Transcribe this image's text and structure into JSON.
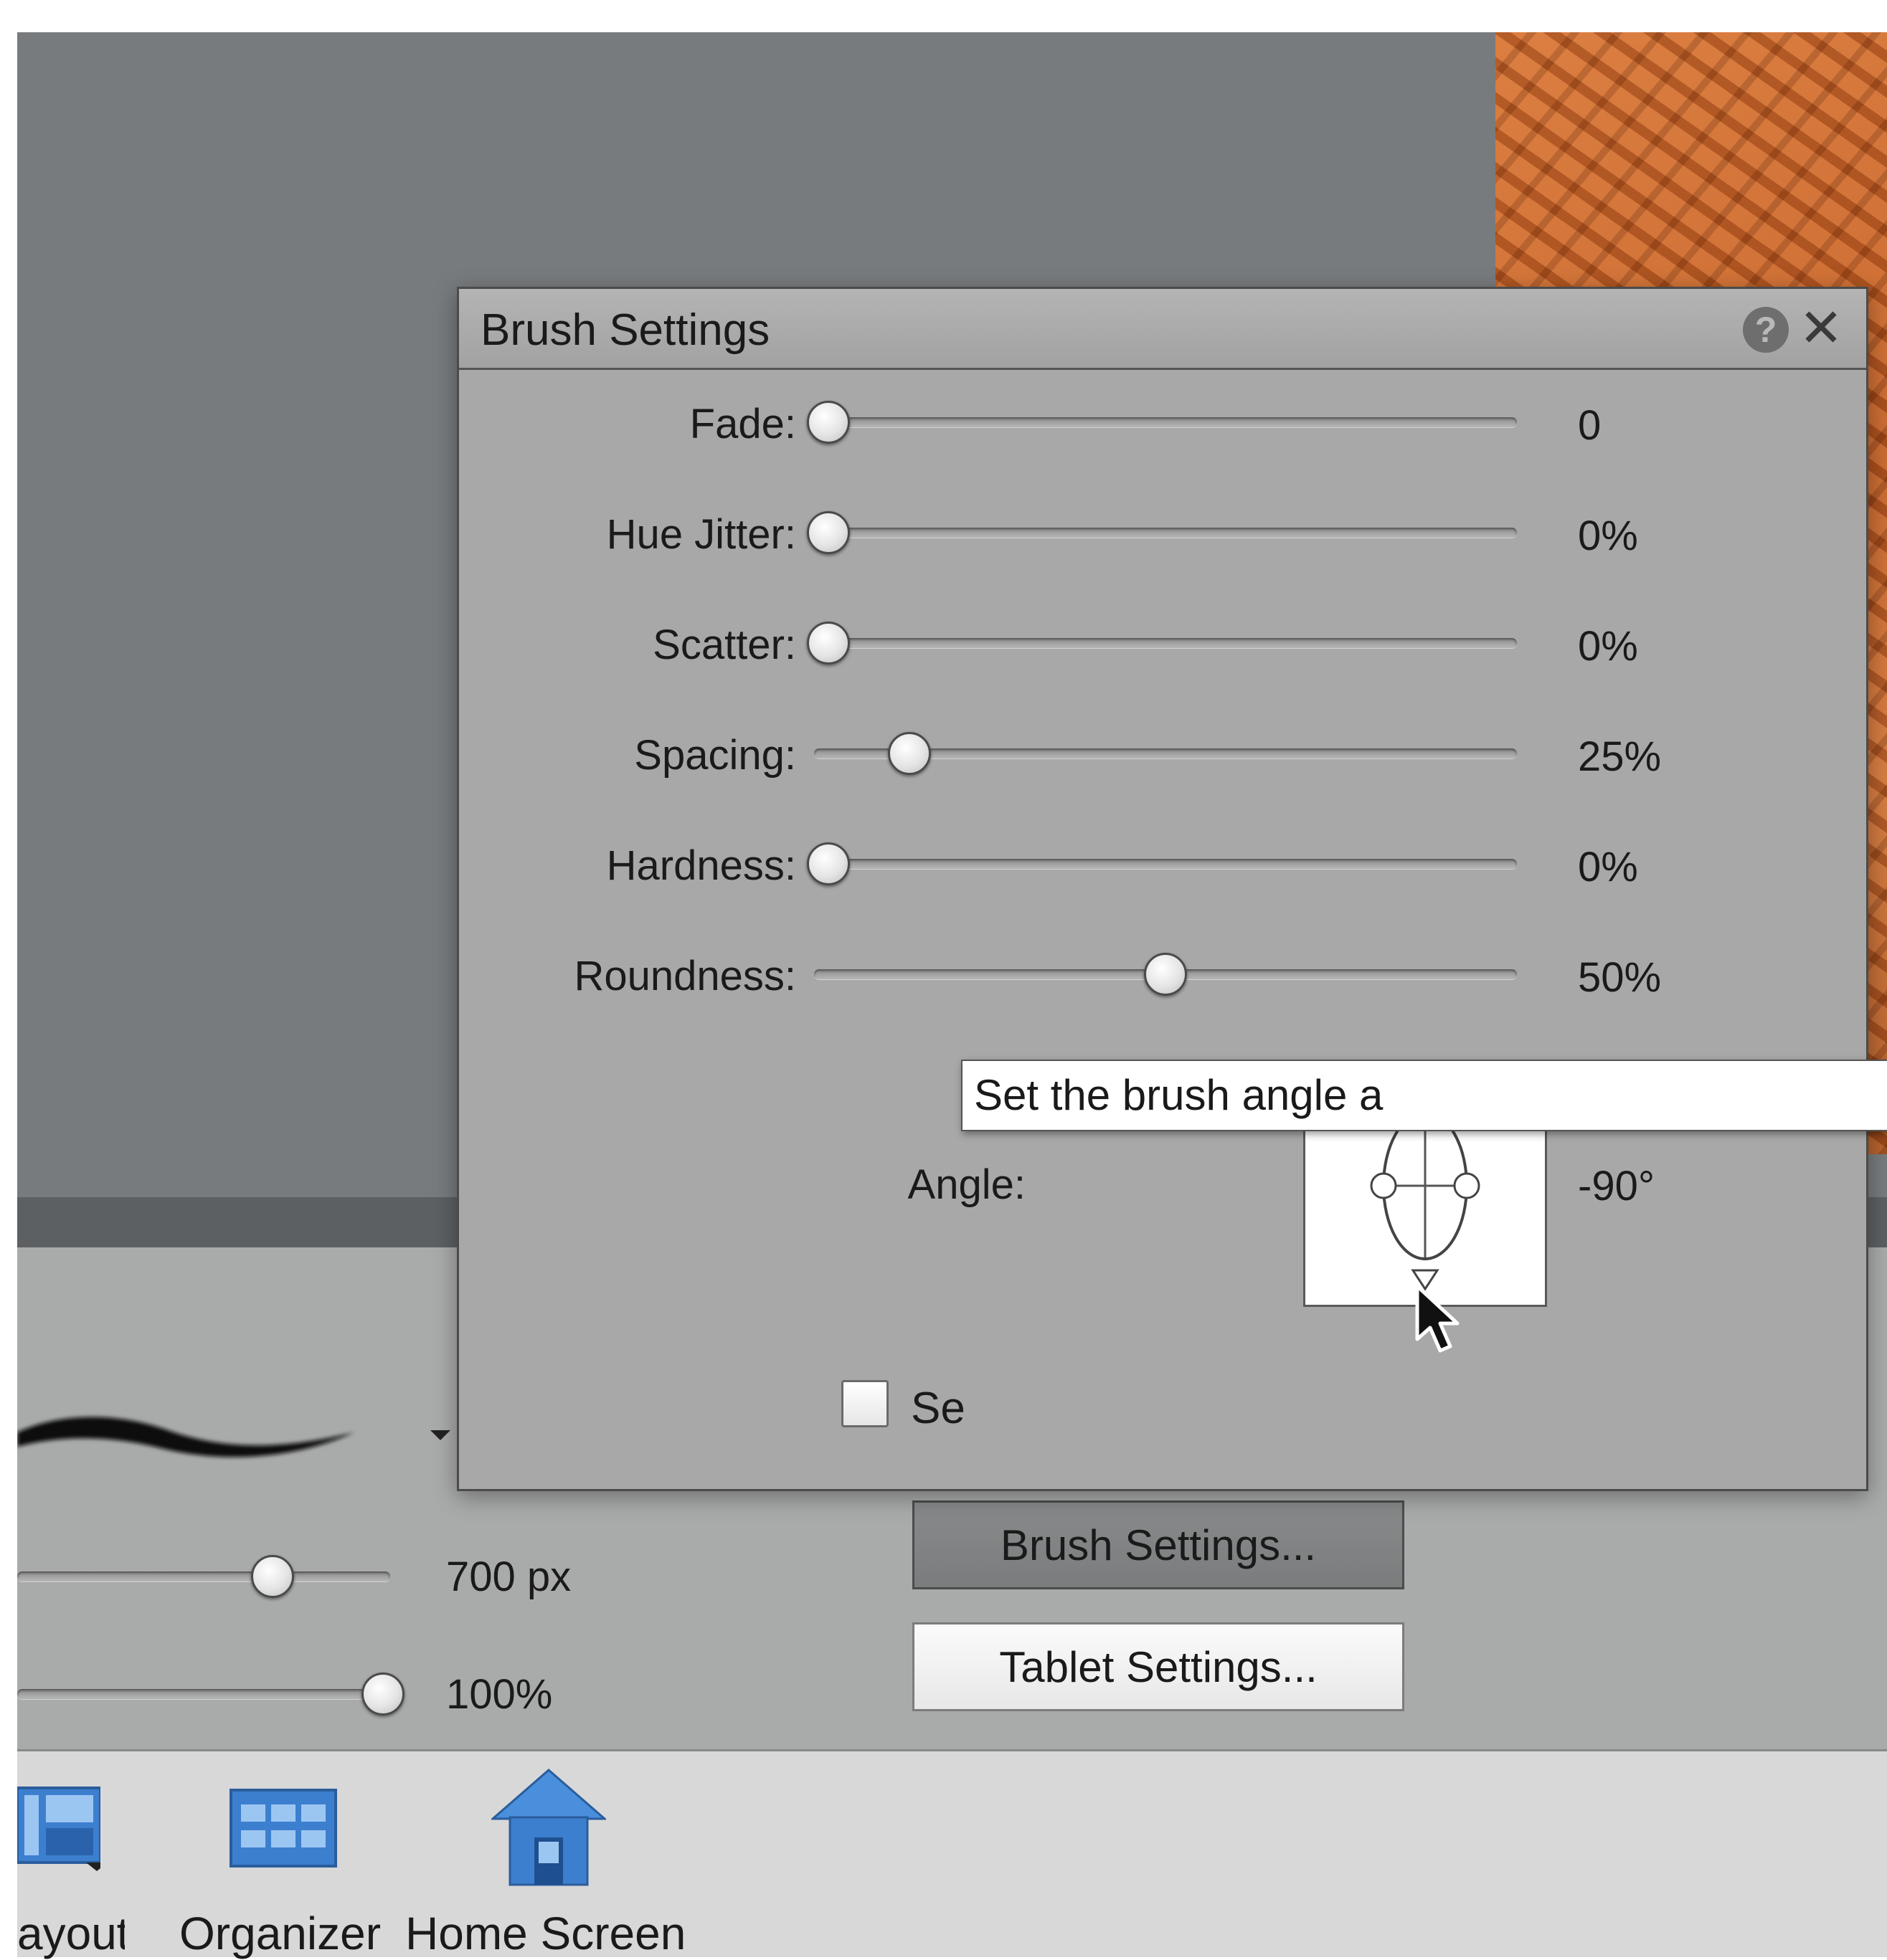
{
  "dialog": {
    "title": "Brush Settings",
    "help_icon": "question-circle-icon",
    "close_icon": "close-icon",
    "sliders": [
      {
        "label": "Fade:",
        "value": "0",
        "fraction": 0.0
      },
      {
        "label": "Hue Jitter:",
        "value": "0%",
        "fraction": 0.0
      },
      {
        "label": "Scatter:",
        "value": "0%",
        "fraction": 0.0
      },
      {
        "label": "Spacing:",
        "value": "25%",
        "fraction": 0.12
      },
      {
        "label": "Hardness:",
        "value": "0%",
        "fraction": 0.0
      },
      {
        "label": "Roundness:",
        "value": "50%",
        "fraction": 0.5
      }
    ],
    "angle": {
      "label": "Angle:",
      "value": "-90°"
    },
    "checkbox_label": "Se",
    "tooltip": "Set the brush angle a"
  },
  "options": {
    "size_value": "700 px",
    "size_fraction": 0.68,
    "opacity_value": "100%",
    "opacity_fraction": 1.0,
    "brush_settings_button": "Brush Settings...",
    "tablet_settings_button": "Tablet Settings..."
  },
  "taskbar": {
    "items": [
      {
        "label": "ayout",
        "icon": "layout-icon"
      },
      {
        "label": "Organizer",
        "icon": "organizer-grid-icon"
      },
      {
        "label": "Home Screen",
        "icon": "home-icon"
      }
    ]
  },
  "colors": {
    "workspace": "#787b7d",
    "dialog_bg": "#a8a8a8",
    "taskbar_bg": "#d8d8d8",
    "icon_blue": "#3d7fcf"
  }
}
